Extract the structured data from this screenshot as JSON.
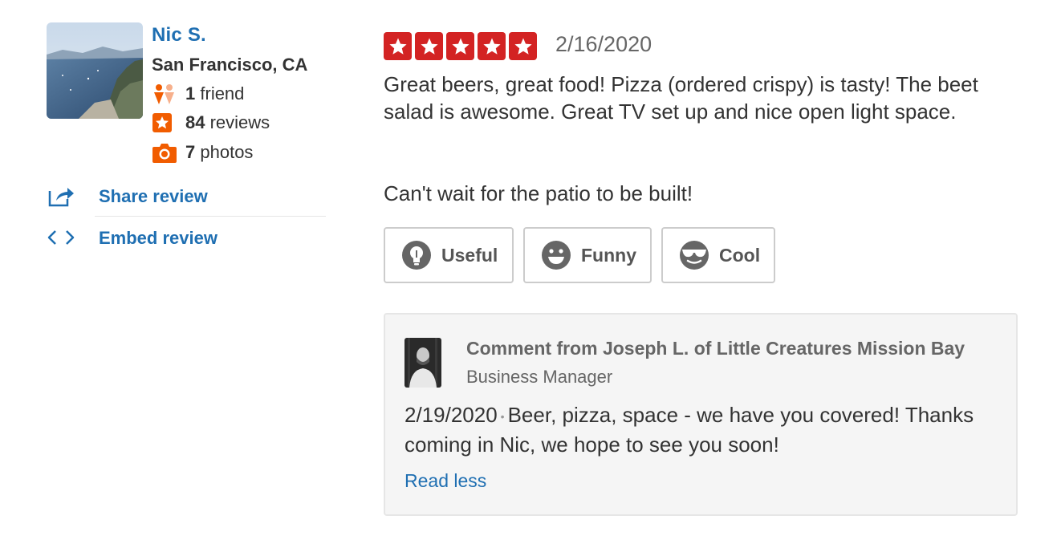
{
  "user": {
    "name": "Nic S.",
    "location": "San Francisco, CA",
    "friends_count": "1",
    "friends_label": "friend",
    "reviews_count": "84",
    "reviews_label": "reviews",
    "photos_count": "7",
    "photos_label": "photos"
  },
  "actions": {
    "share_label": "Share review",
    "embed_label": "Embed review"
  },
  "review": {
    "rating": 5,
    "max_rating": 5,
    "date": "2/16/2020",
    "paragraph1": "Great beers, great food! Pizza (ordered crispy) is tasty! The beet salad is awesome. Great TV set up and nice open light space.",
    "paragraph2": "Can't wait for the patio to be built!"
  },
  "votes": {
    "useful_label": "Useful",
    "funny_label": "Funny",
    "cool_label": "Cool"
  },
  "business_comment": {
    "title": "Comment from Joseph L. of Little Creatures Mission Bay",
    "role": "Business Manager",
    "date": "2/19/2020",
    "text": "Beer, pizza, space - we have you covered! Thanks coming in Nic, we hope to see you soon!",
    "read_less_label": "Read less"
  },
  "colors": {
    "link": "#1f6fb2",
    "star": "#d32323",
    "orange_icon": "#f15c00",
    "vote_icon": "#666666"
  },
  "icons": {
    "friend": "friends-icon",
    "reviews": "review-star-icon",
    "photos": "camera-icon",
    "share": "share-icon",
    "embed": "embed-code-icon",
    "useful": "lightbulb-icon",
    "funny": "smiley-icon",
    "cool": "sunglasses-icon",
    "star": "star-icon"
  }
}
